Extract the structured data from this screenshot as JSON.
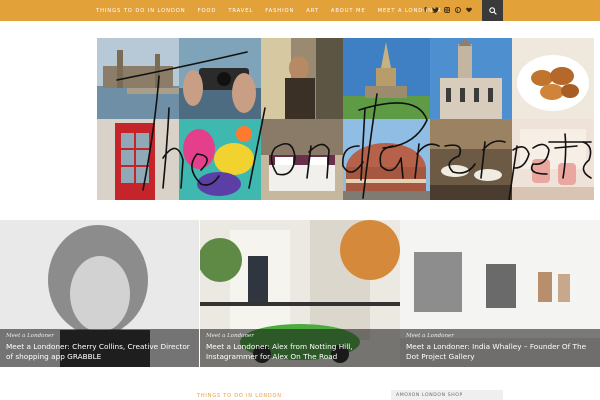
{
  "nav": {
    "items": [
      "THINGS TO DO IN LONDON",
      "FOOD",
      "TRAVEL",
      "FASHION",
      "ART",
      "ABOUT ME",
      "MEET A LONDONER"
    ],
    "social_icons": [
      "facebook-icon",
      "twitter-icon",
      "instagram-icon",
      "pinterest-icon",
      "heart-icon"
    ],
    "search_icon": "search-icon"
  },
  "colors": {
    "accent": "#e3a13a",
    "search_bg": "#3a3a3a"
  },
  "logo": {
    "text": "The London Perspective"
  },
  "features": [
    {
      "kicker": "Meet a Londoner",
      "title": "Meet a Londoner: Cherry Collins, Creative Director of shopping app GRABBLE"
    },
    {
      "kicker": "Meet a Londoner",
      "title": "Meet a Londoner: Alex from Notting Hill, Instagrammer for Alex On The Road"
    },
    {
      "kicker": "Meet a Londoner",
      "title": "Meet a Londoner: India Whalley – Founder Of The Dot Project Gallery"
    }
  ],
  "sections": {
    "main_heading": "THINGS TO DO IN LONDON",
    "sidebar_heading": "AMOXON LONDON SHOP"
  }
}
